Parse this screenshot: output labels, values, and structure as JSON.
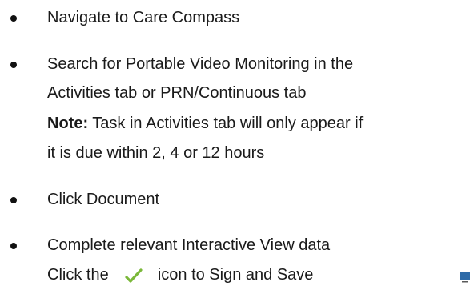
{
  "steps": [
    {
      "text": "Navigate to Care Compass"
    },
    {
      "line1": "Search for Portable Video Monitoring in the",
      "line2": "Activities tab or PRN/Continuous tab",
      "note_label": "Note:",
      "note_text": " Task in Activities tab will only appear if",
      "note_line2": "it is due within 2, 4 or 12 hours"
    },
    {
      "text": "Click Document"
    },
    {
      "text": "Complete relevant Interactive View data",
      "sub_before": "Click the",
      "sub_after": "icon to Sign and Save",
      "icon": "checkmark-icon",
      "icon_color": "#7bb83a"
    }
  ],
  "colors": {
    "text": "#1a1a1a",
    "bullet": "#111111",
    "corner": "#2e6ba8"
  }
}
